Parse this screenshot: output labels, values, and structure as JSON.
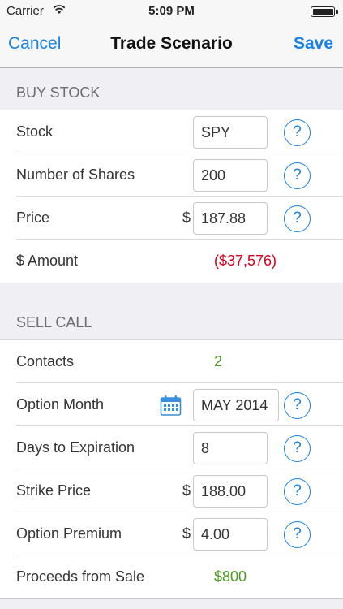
{
  "status_bar": {
    "carrier": "Carrier",
    "time": "5:09 PM"
  },
  "nav": {
    "cancel": "Cancel",
    "title": "Trade Scenario",
    "save": "Save"
  },
  "buy_section": {
    "header": "BUY STOCK",
    "stock_label": "Stock",
    "stock_value": "SPY",
    "shares_label": "Number of Shares",
    "shares_value": "200",
    "price_label": "Price",
    "price_currency": "$",
    "price_value": "187.88",
    "amount_label": "$ Amount",
    "amount_value": "($37,576)"
  },
  "sell_section": {
    "header": "SELL CALL",
    "contacts_label": "Contacts",
    "contacts_value": "2",
    "month_label": "Option Month",
    "month_value": "MAY 2014",
    "days_label": "Days to Expiration",
    "days_value": "8",
    "strike_label": "Strike Price",
    "strike_currency": "$",
    "strike_value": "188.00",
    "premium_label": "Option Premium",
    "premium_currency": "$",
    "premium_value": "4.00",
    "proceeds_label": "Proceeds from Sale",
    "proceeds_value": "$800"
  },
  "help_symbol": "?",
  "colors": {
    "accent": "#1a82e2",
    "negative": "#d0021b",
    "positive": "#4a9c1c"
  },
  "icons": [
    "wifi-icon",
    "battery-icon",
    "calendar-icon",
    "help-icon"
  ]
}
